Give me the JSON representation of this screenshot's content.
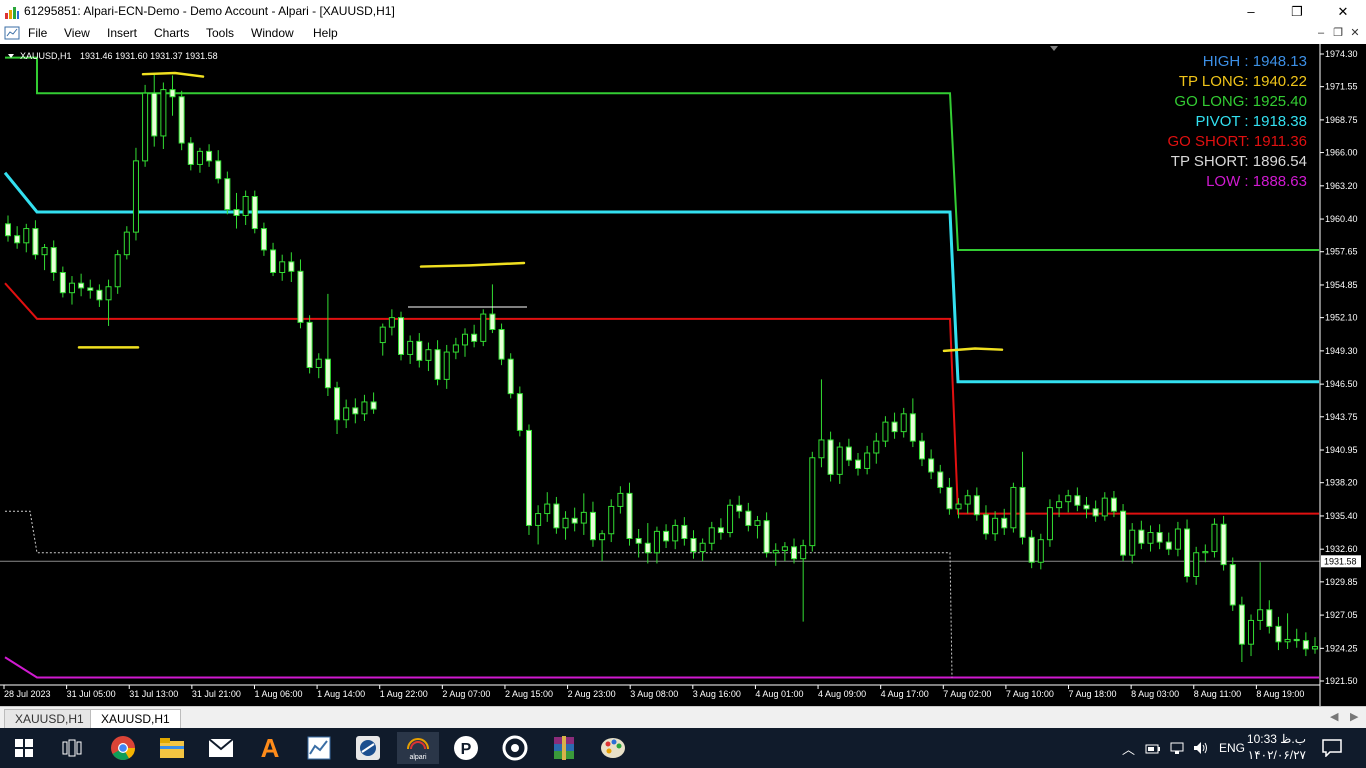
{
  "window": {
    "title": "61295851: Alpari-ECN-Demo - Demo Account - Alpari - [XAUUSD,H1]",
    "minimize": "–",
    "maximize": "❐",
    "close": "✕"
  },
  "menu": {
    "items": [
      "File",
      "View",
      "Insert",
      "Charts",
      "Tools",
      "Window",
      "Help"
    ]
  },
  "chart_data": {
    "type": "candlestick",
    "header": {
      "symbol": "XAUUSD,H1",
      "ohlc": "1931.46 1931.60 1931.37 1931.58"
    },
    "price_axis": {
      "labels": [
        "1974.30",
        "1971.55",
        "1968.75",
        "1966.00",
        "1963.20",
        "1960.40",
        "1957.65",
        "1954.85",
        "1952.10",
        "1949.30",
        "1946.50",
        "1943.75",
        "1940.95",
        "1938.20",
        "1935.40",
        "1932.60",
        "1929.85",
        "1927.05",
        "1924.25",
        "1921.50"
      ],
      "max": 1974.3,
      "min": 1921.5
    },
    "current_price": "1931.58",
    "time_axis": [
      "28 Jul 2023",
      "31 Jul 05:00",
      "31 Jul 13:00",
      "31 Jul 21:00",
      "1 Aug 06:00",
      "1 Aug 14:00",
      "1 Aug 22:00",
      "2 Aug 07:00",
      "2 Aug 15:00",
      "2 Aug 23:00",
      "3 Aug 08:00",
      "3 Aug 16:00",
      "4 Aug 01:00",
      "4 Aug 09:00",
      "4 Aug 17:00",
      "7 Aug 02:00",
      "7 Aug 10:00",
      "7 Aug 18:00",
      "8 Aug 03:00",
      "8 Aug 11:00",
      "8 Aug 19:00"
    ],
    "levels": [
      {
        "name": "HIGH",
        "value": "1948.13",
        "color": "#3c8fe6"
      },
      {
        "name": "TP LONG",
        "value": "1940.22",
        "color": "#f0c419"
      },
      {
        "name": "GO LONG",
        "value": "1925.40",
        "color": "#33cc33"
      },
      {
        "name": "PIVOT",
        "value": "1918.38",
        "color": "#33e0f0"
      },
      {
        "name": "GO SHORT",
        "value": "1911.36",
        "color": "#e01010"
      },
      {
        "name": "TP SHORT",
        "value": "1896.54",
        "color": "#d8d8d8"
      },
      {
        "name": "LOW",
        "value": "1888.63",
        "color": "#d01ad0"
      }
    ],
    "step_lines": [
      {
        "color": "#33cc33",
        "points": [
          [
            1974.0,
            1974.0
          ],
          [
            1971.0,
            1971.0
          ],
          [
            1971.0,
            1957.8
          ]
        ]
      },
      {
        "color": "#33e0f0",
        "points": [
          [
            1964.3,
            1961.0
          ],
          [
            1961.0,
            1961.0
          ],
          [
            1961.0,
            1946.7
          ]
        ]
      },
      {
        "color": "#e01010",
        "points": [
          [
            1955.0,
            1952.0
          ],
          [
            1952.0,
            1952.0
          ],
          [
            1952.0,
            1935.6
          ]
        ]
      },
      {
        "color": "#d01ad0",
        "points": [
          [
            1923.5,
            1921.8
          ],
          [
            1921.8,
            1921.8
          ],
          [
            1921.8,
            1921.8
          ]
        ]
      }
    ],
    "candles": [
      [
        1960.0,
        1960.7,
        1958.5,
        1959.0
      ],
      [
        1959.0,
        1959.8,
        1957.9,
        1958.4
      ],
      [
        1958.4,
        1960.0,
        1957.6,
        1959.6
      ],
      [
        1959.6,
        1960.3,
        1957.0,
        1957.4
      ],
      [
        1957.4,
        1958.3,
        1956.1,
        1958.0
      ],
      [
        1958.0,
        1958.6,
        1955.2,
        1955.9
      ],
      [
        1955.9,
        1956.4,
        1953.8,
        1954.2
      ],
      [
        1954.2,
        1955.6,
        1953.2,
        1955.0
      ],
      [
        1955.0,
        1955.8,
        1953.9,
        1954.6
      ],
      [
        1954.6,
        1955.3,
        1953.7,
        1954.4
      ],
      [
        1954.4,
        1954.9,
        1953.0,
        1953.6
      ],
      [
        1953.6,
        1955.3,
        1951.4,
        1954.7
      ],
      [
        1954.7,
        1957.8,
        1954.1,
        1957.4
      ],
      [
        1957.4,
        1959.8,
        1957.0,
        1959.3
      ],
      [
        1959.3,
        1966.4,
        1958.6,
        1965.3
      ],
      [
        1965.3,
        1971.7,
        1964.8,
        1971.0
      ],
      [
        1971.0,
        1972.7,
        1966.5,
        1967.4
      ],
      [
        1967.4,
        1971.9,
        1966.3,
        1971.3
      ],
      [
        1971.3,
        1972.5,
        1969.1,
        1970.7
      ],
      [
        1970.7,
        1971.2,
        1966.2,
        1966.8
      ],
      [
        1966.8,
        1967.3,
        1964.5,
        1965.0
      ],
      [
        1965.0,
        1966.4,
        1964.3,
        1966.1
      ],
      [
        1966.1,
        1966.7,
        1964.8,
        1965.3
      ],
      [
        1965.3,
        1966.2,
        1963.4,
        1963.8
      ],
      [
        1963.8,
        1964.4,
        1960.8,
        1961.2
      ],
      [
        1961.2,
        1962.6,
        1959.6,
        1960.7
      ],
      [
        1960.7,
        1962.8,
        1959.9,
        1962.3
      ],
      [
        1962.3,
        1962.8,
        1959.2,
        1959.6
      ],
      [
        1959.6,
        1960.1,
        1957.3,
        1957.8
      ],
      [
        1957.8,
        1958.4,
        1955.6,
        1955.9
      ],
      [
        1955.9,
        1957.4,
        1955.2,
        1956.8
      ],
      [
        1956.8,
        1957.6,
        1955.1,
        1956.0
      ],
      [
        1956.0,
        1957.0,
        1951.2,
        1951.7
      ],
      [
        1951.7,
        1952.3,
        1947.4,
        1947.9
      ],
      [
        1947.9,
        1949.1,
        1947.0,
        1948.6
      ],
      [
        1948.6,
        1954.1,
        1945.5,
        1946.2
      ],
      [
        1946.2,
        1946.7,
        1942.3,
        1943.5
      ],
      [
        1943.5,
        1945.2,
        1942.8,
        1944.5
      ],
      [
        1944.5,
        1945.3,
        1943.2,
        1944.0
      ],
      [
        1944.0,
        1945.6,
        1943.4,
        1945.0
      ],
      [
        1945.0,
        1945.8,
        1944.0,
        1944.4
      ],
      [
        1950.0,
        1951.6,
        1948.9,
        1951.3
      ],
      [
        1951.3,
        1952.8,
        1950.6,
        1952.1
      ],
      [
        1952.1,
        1952.6,
        1948.5,
        1949.0
      ],
      [
        1949.0,
        1950.6,
        1948.2,
        1950.1
      ],
      [
        1950.1,
        1950.8,
        1947.9,
        1948.5
      ],
      [
        1948.5,
        1950.0,
        1947.6,
        1949.4
      ],
      [
        1949.4,
        1950.2,
        1946.4,
        1946.9
      ],
      [
        1946.9,
        1949.8,
        1946.1,
        1949.2
      ],
      [
        1949.2,
        1950.4,
        1948.6,
        1949.8
      ],
      [
        1949.8,
        1951.2,
        1948.8,
        1950.7
      ],
      [
        1950.7,
        1951.5,
        1949.6,
        1950.1
      ],
      [
        1950.1,
        1952.8,
        1949.7,
        1952.4
      ],
      [
        1952.4,
        1954.9,
        1950.8,
        1951.1
      ],
      [
        1951.1,
        1951.6,
        1948.1,
        1948.6
      ],
      [
        1948.6,
        1949.1,
        1945.3,
        1945.7
      ],
      [
        1945.7,
        1946.3,
        1942.1,
        1942.6
      ],
      [
        1942.6,
        1943.1,
        1933.8,
        1934.6
      ],
      [
        1934.6,
        1936.3,
        1933.0,
        1935.6
      ],
      [
        1935.6,
        1937.4,
        1934.9,
        1936.4
      ],
      [
        1936.4,
        1937.0,
        1933.9,
        1934.4
      ],
      [
        1934.4,
        1935.8,
        1933.4,
        1935.2
      ],
      [
        1935.2,
        1936.1,
        1934.1,
        1934.8
      ],
      [
        1934.8,
        1937.3,
        1933.8,
        1935.7
      ],
      [
        1935.7,
        1936.6,
        1932.8,
        1933.4
      ],
      [
        1933.4,
        1934.2,
        1931.6,
        1933.9
      ],
      [
        1933.9,
        1936.8,
        1933.2,
        1936.2
      ],
      [
        1936.2,
        1937.9,
        1935.6,
        1937.3
      ],
      [
        1937.3,
        1938.2,
        1932.9,
        1933.5
      ],
      [
        1933.5,
        1934.3,
        1931.9,
        1933.1
      ],
      [
        1933.1,
        1934.8,
        1931.4,
        1932.3
      ],
      [
        1932.3,
        1934.5,
        1931.4,
        1934.1
      ],
      [
        1934.1,
        1934.7,
        1932.7,
        1933.3
      ],
      [
        1933.3,
        1935.1,
        1932.6,
        1934.6
      ],
      [
        1934.6,
        1935.3,
        1932.9,
        1933.5
      ],
      [
        1933.5,
        1934.2,
        1931.8,
        1932.4
      ],
      [
        1932.4,
        1933.5,
        1931.6,
        1933.1
      ],
      [
        1933.1,
        1934.9,
        1932.5,
        1934.4
      ],
      [
        1934.4,
        1935.2,
        1933.4,
        1934.0
      ],
      [
        1934.0,
        1936.8,
        1933.6,
        1936.3
      ],
      [
        1936.3,
        1937.1,
        1935.2,
        1935.8
      ],
      [
        1935.8,
        1936.5,
        1934.1,
        1934.6
      ],
      [
        1934.6,
        1935.4,
        1933.5,
        1935.0
      ],
      [
        1935.0,
        1935.7,
        1931.9,
        1932.3
      ],
      [
        1932.3,
        1933.1,
        1931.2,
        1932.5
      ],
      [
        1932.5,
        1933.2,
        1931.6,
        1932.8
      ],
      [
        1932.8,
        1933.5,
        1931.4,
        1931.8
      ],
      [
        1931.8,
        1933.4,
        1926.5,
        1932.9
      ],
      [
        1932.9,
        1940.8,
        1932.4,
        1940.3
      ],
      [
        1940.3,
        1946.9,
        1939.5,
        1941.8
      ],
      [
        1941.8,
        1942.5,
        1938.3,
        1938.9
      ],
      [
        1938.9,
        1941.6,
        1938.1,
        1941.2
      ],
      [
        1941.2,
        1941.9,
        1939.6,
        1940.1
      ],
      [
        1940.1,
        1940.7,
        1938.8,
        1939.4
      ],
      [
        1939.4,
        1941.3,
        1938.9,
        1940.7
      ],
      [
        1940.7,
        1942.4,
        1939.8,
        1941.7
      ],
      [
        1941.7,
        1943.8,
        1941.2,
        1943.3
      ],
      [
        1943.3,
        1944.1,
        1941.9,
        1942.5
      ],
      [
        1942.5,
        1944.5,
        1942.0,
        1944.0
      ],
      [
        1944.0,
        1945.3,
        1941.2,
        1941.7
      ],
      [
        1941.7,
        1942.4,
        1939.6,
        1940.2
      ],
      [
        1940.2,
        1941.0,
        1938.5,
        1939.1
      ],
      [
        1939.1,
        1939.7,
        1937.3,
        1937.8
      ],
      [
        1937.8,
        1938.6,
        1935.5,
        1936.0
      ],
      [
        1936.0,
        1936.9,
        1935.2,
        1936.4
      ],
      [
        1936.4,
        1937.6,
        1935.6,
        1937.1
      ],
      [
        1937.1,
        1937.8,
        1935.0,
        1935.5
      ],
      [
        1935.5,
        1936.3,
        1933.4,
        1933.9
      ],
      [
        1933.9,
        1935.8,
        1933.3,
        1935.2
      ],
      [
        1935.2,
        1936.0,
        1933.8,
        1934.4
      ],
      [
        1934.4,
        1938.2,
        1934.0,
        1937.8
      ],
      [
        1937.8,
        1940.8,
        1933.0,
        1933.6
      ],
      [
        1933.6,
        1934.2,
        1931.0,
        1931.5
      ],
      [
        1931.5,
        1933.9,
        1930.9,
        1933.4
      ],
      [
        1933.4,
        1936.8,
        1932.8,
        1936.1
      ],
      [
        1936.1,
        1937.2,
        1935.3,
        1936.6
      ],
      [
        1936.6,
        1937.6,
        1935.7,
        1937.1
      ],
      [
        1937.1,
        1937.8,
        1935.8,
        1936.3
      ],
      [
        1936.3,
        1937.0,
        1935.2,
        1936.0
      ],
      [
        1936.0,
        1936.7,
        1934.9,
        1935.4
      ],
      [
        1935.4,
        1937.4,
        1935.0,
        1936.9
      ],
      [
        1936.9,
        1937.5,
        1935.3,
        1935.8
      ],
      [
        1935.8,
        1936.4,
        1931.6,
        1932.1
      ],
      [
        1932.1,
        1934.8,
        1931.4,
        1934.2
      ],
      [
        1934.2,
        1935.0,
        1932.6,
        1933.1
      ],
      [
        1933.1,
        1934.6,
        1932.4,
        1934.0
      ],
      [
        1934.0,
        1934.7,
        1932.6,
        1933.2
      ],
      [
        1933.2,
        1934.0,
        1932.1,
        1932.6
      ],
      [
        1932.6,
        1934.9,
        1932.0,
        1934.3
      ],
      [
        1934.3,
        1935.1,
        1929.8,
        1930.3
      ],
      [
        1930.3,
        1932.8,
        1929.6,
        1932.3
      ],
      [
        1932.3,
        1933.0,
        1931.5,
        1932.4
      ],
      [
        1932.4,
        1935.2,
        1931.9,
        1934.7
      ],
      [
        1934.7,
        1935.4,
        1930.8,
        1931.3
      ],
      [
        1931.3,
        1931.9,
        1927.4,
        1927.9
      ],
      [
        1927.9,
        1928.6,
        1923.1,
        1924.6
      ],
      [
        1924.6,
        1927.1,
        1923.6,
        1926.6
      ],
      [
        1926.6,
        1931.5,
        1925.8,
        1927.5
      ],
      [
        1927.5,
        1928.3,
        1925.5,
        1926.1
      ],
      [
        1926.1,
        1926.9,
        1924.1,
        1924.8
      ],
      [
        1924.8,
        1927.2,
        1924.2,
        1925.0
      ],
      [
        1925.0,
        1925.9,
        1924.3,
        1924.9
      ],
      [
        1924.9,
        1925.6,
        1923.6,
        1924.2
      ],
      [
        1924.2,
        1925.2,
        1923.8,
        1924.4
      ]
    ]
  },
  "tabs": [
    "XAUUSD,H1",
    "XAUUSD,H1"
  ],
  "taskbar": {
    "tray": {
      "language": "ENG",
      "time": "10:33 ب.ظ",
      "date": "۱۴۰۲/۰۶/۲۷"
    }
  }
}
